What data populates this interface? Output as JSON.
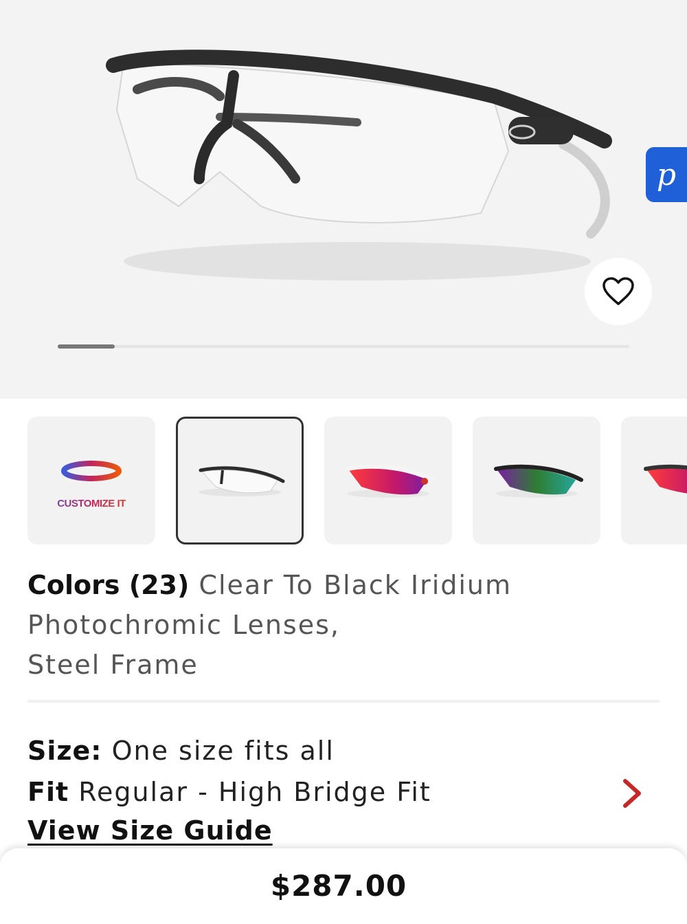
{
  "hero": {
    "image_alt": "Radar EV sunglasses, Clear To Black Iridium Photochromic lenses, Steel frame",
    "pbadge_letter": "p",
    "favorite_icon": "heart-outline-icon",
    "gallery_progress": 0.1
  },
  "thumbnails": [
    {
      "kind": "customize",
      "label": "CUSTOMIZE IT",
      "selected": false
    },
    {
      "kind": "variant",
      "lens": "clear",
      "selected": true
    },
    {
      "kind": "variant",
      "lens": "red-iridium",
      "selected": false
    },
    {
      "kind": "variant",
      "lens": "green-iridium",
      "selected": false
    },
    {
      "kind": "variant",
      "lens": "red-iridium",
      "selected": false
    }
  ],
  "colors": {
    "label": "Colors (23)",
    "value_line1": "Clear To Black Iridium",
    "value_line2": "Photochromic Lenses,",
    "value_line3": "Steel Frame"
  },
  "size": {
    "label": "Size:",
    "value": "One size fits all"
  },
  "fit": {
    "label": "Fit",
    "value": "Regular - High Bridge Fit",
    "chevron_icon": "chevron-right-icon",
    "chevron_color": "#c62828"
  },
  "size_guide": {
    "label": "View Size Guide"
  },
  "price_bar": {
    "price": "$287.00"
  },
  "colors_theme": {
    "badge_blue": "#1f5fd8",
    "selected_border": "#333333"
  }
}
